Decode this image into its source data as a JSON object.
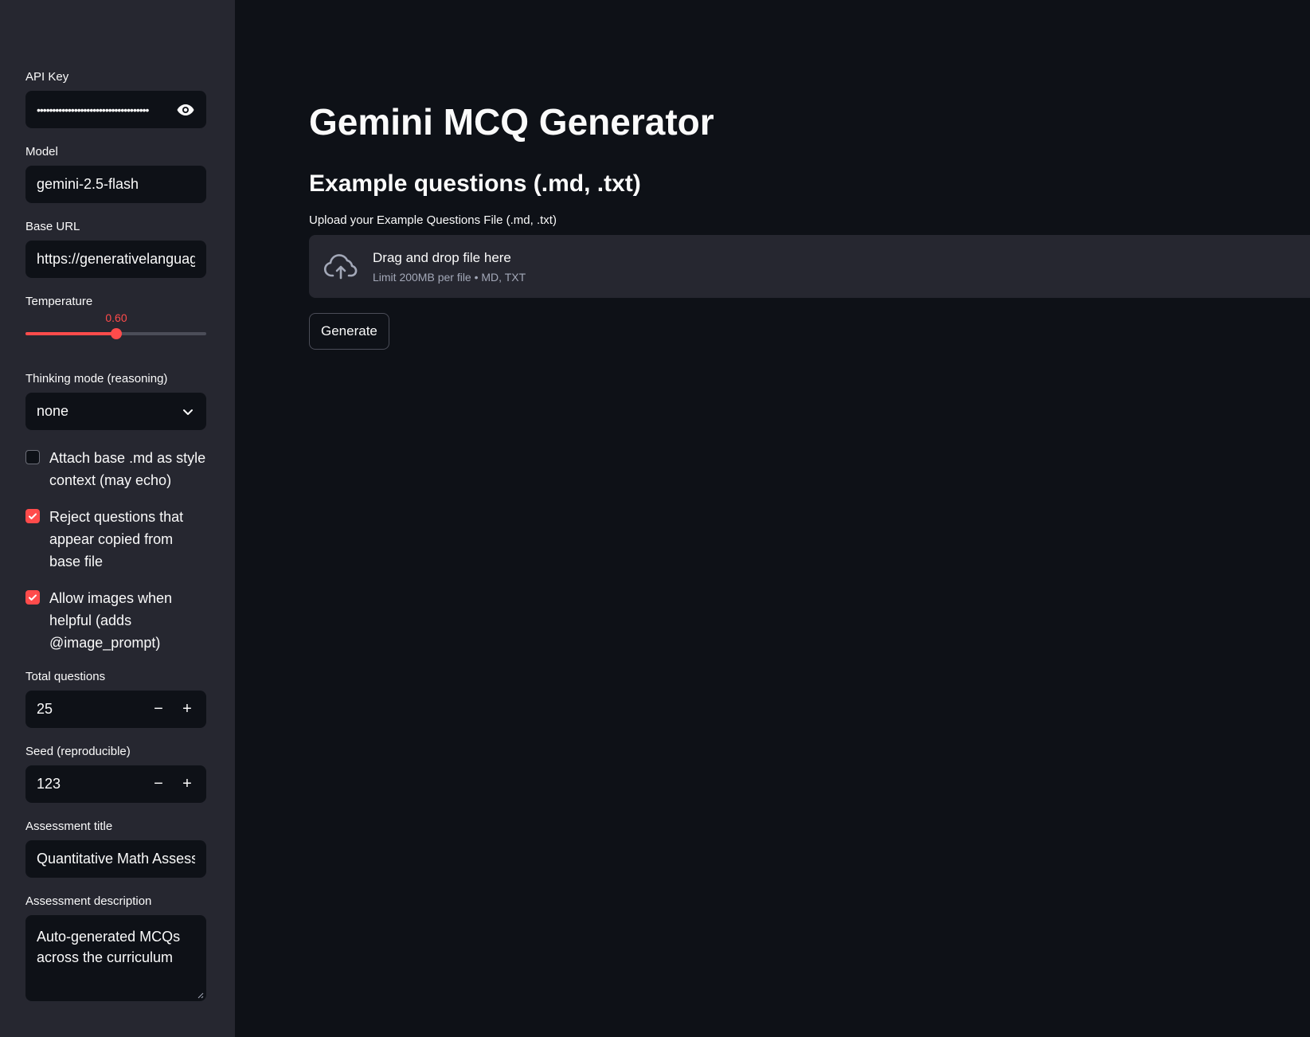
{
  "sidebar": {
    "api_key": {
      "label": "API Key",
      "value": "••••••••••••••••••••••••••••••••••••"
    },
    "model": {
      "label": "Model",
      "value": "gemini-2.5-flash"
    },
    "base_url": {
      "label": "Base URL",
      "value": "https://generativelanguag"
    },
    "temperature": {
      "label": "Temperature",
      "value_text": "0.60",
      "value": 0.6,
      "min": 0,
      "max": 1.2
    },
    "thinking_mode": {
      "label": "Thinking mode (reasoning)",
      "value": "none"
    },
    "checkboxes": [
      {
        "label": "Attach base .md as style context (may echo)",
        "checked": false
      },
      {
        "label": "Reject questions that appear copied from base file",
        "checked": true
      },
      {
        "label": "Allow images when helpful (adds @image_prompt)",
        "checked": true
      }
    ],
    "total_questions": {
      "label": "Total questions",
      "value": "25",
      "minus": "−",
      "plus": "+"
    },
    "seed": {
      "label": "Seed (reproducible)",
      "value": "123",
      "minus": "−",
      "plus": "+"
    },
    "assessment_title": {
      "label": "Assessment title",
      "value": "Quantitative Math Assessment"
    },
    "assessment_description": {
      "label": "Assessment description",
      "value": "Auto-generated MCQs across the curriculum"
    }
  },
  "main": {
    "title": "Gemini MCQ Generator",
    "section_title": "Example questions (.md, .txt)",
    "upload": {
      "label": "Upload your Example Questions File (.md, .txt)",
      "drop_text": "Drag and drop file here",
      "limit_text": "Limit 200MB per file • MD, TXT"
    },
    "generate_label": "Generate"
  },
  "colors": {
    "accent": "#ff4b4b",
    "sidebar_bg": "#262730",
    "main_bg": "#0e1117"
  },
  "icons": {
    "password_toggle": "eye-icon",
    "select": "chevron-down-icon",
    "upload": "cloud-upload-icon"
  }
}
